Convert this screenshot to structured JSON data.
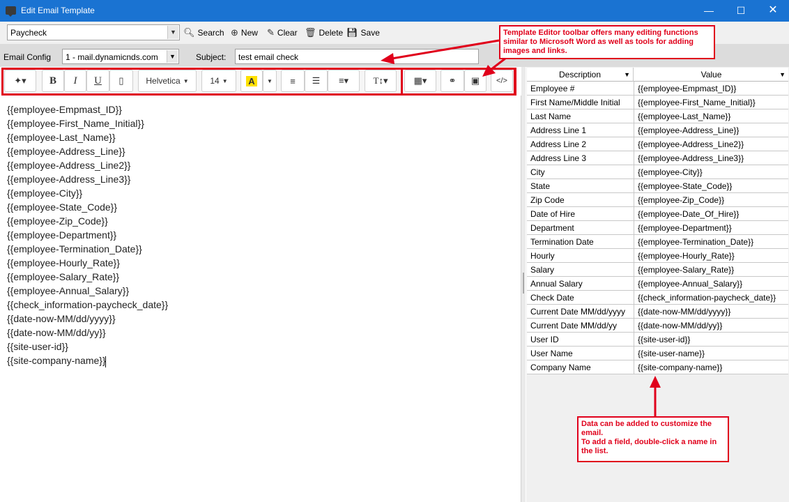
{
  "window": {
    "title": "Edit Email Template",
    "controls": [
      "minimize-icon",
      "maximize-icon",
      "close-icon"
    ]
  },
  "toolbar": {
    "template_select": "Paycheck",
    "search_label": "Search",
    "new_label": "New",
    "clear_label": "Clear",
    "delete_label": "Delete",
    "save_label": "Save"
  },
  "config": {
    "email_config_label": "Email Config",
    "email_config_value": "1 - mail.dynamicnds.com",
    "subject_label": "Subject:",
    "subject_value": "test email check"
  },
  "editor_toolbar": {
    "font_name": "Helvetica",
    "font_size": "14",
    "highlight_letter": "A",
    "bold": "B",
    "italic": "I",
    "underline": "U",
    "code_label": "</>"
  },
  "editor": {
    "lines": [
      "{{employee-Empmast_ID}}",
      "{{employee-First_Name_Initial}}",
      "{{employee-Last_Name}}",
      "{{employee-Address_Line}}",
      "{{employee-Address_Line2}}",
      "{{employee-Address_Line3}}",
      "{{employee-City}}",
      "{{employee-State_Code}}",
      "{{employee-Zip_Code}}",
      "{{employee-Department}}",
      "{{employee-Termination_Date}}",
      "{{employee-Hourly_Rate}}",
      "{{employee-Salary_Rate}}",
      "{{employee-Annual_Salary}}",
      "{{check_information-paycheck_date}}",
      "{{date-now-MM/dd/yyyy}}",
      "{{date-now-MM/dd/yy}}",
      "{{site-user-id}}",
      "{{site-company-name}}"
    ]
  },
  "grid": {
    "headers": [
      "Description",
      "Value"
    ],
    "rows": [
      [
        "Employee #",
        "{{employee-Empmast_ID}}"
      ],
      [
        "First Name/Middle Initial",
        "{{employee-First_Name_Initial}}"
      ],
      [
        "Last Name",
        "{{employee-Last_Name}}"
      ],
      [
        "Address Line 1",
        "{{employee-Address_Line}}"
      ],
      [
        "Address Line 2",
        "{{employee-Address_Line2}}"
      ],
      [
        "Address Line 3",
        "{{employee-Address_Line3}}"
      ],
      [
        "City",
        "{{employee-City}}"
      ],
      [
        "State",
        "{{employee-State_Code}}"
      ],
      [
        "Zip Code",
        "{{employee-Zip_Code}}"
      ],
      [
        "Date of Hire",
        "{{employee-Date_Of_Hire}}"
      ],
      [
        "Department",
        "{{employee-Department}}"
      ],
      [
        "Termination Date",
        "{{employee-Termination_Date}}"
      ],
      [
        "Hourly",
        "{{employee-Hourly_Rate}}"
      ],
      [
        "Salary",
        "{{employee-Salary_Rate}}"
      ],
      [
        "Annual Salary",
        "{{employee-Annual_Salary}}"
      ],
      [
        "Check Date",
        "{{check_information-paycheck_date}}"
      ],
      [
        "Current Date MM/dd/yyyy",
        "{{date-now-MM/dd/yyyy}}"
      ],
      [
        "Current Date MM/dd/yy",
        "{{date-now-MM/dd/yy}}"
      ],
      [
        "User ID",
        "{{site-user-id}}"
      ],
      [
        "User Name",
        "{{site-user-name}}"
      ],
      [
        "Company Name",
        "{{site-company-name}}"
      ]
    ]
  },
  "annotations": {
    "toolbar_note": "Template Editor toolbar offers many editing functions similar to Microsoft Word as well as tools for adding images and links.",
    "data_note_1": "Data can be added to customize the email.",
    "data_note_2": "To add a field, double-click a name in the list.",
    "accent_color": "#e0001b"
  }
}
